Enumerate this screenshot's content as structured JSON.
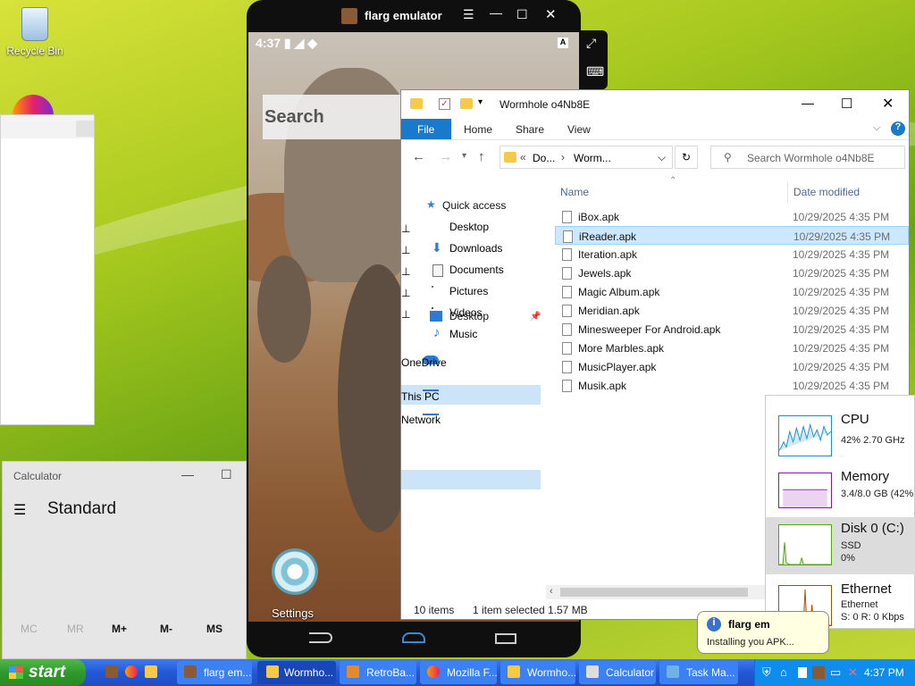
{
  "desktop": {
    "recycle_bin_label": "Recycle Bin"
  },
  "calculator": {
    "title": "Calculator",
    "mode": "Standard",
    "memory_buttons": [
      "MC",
      "MR",
      "M+",
      "M-",
      "MS"
    ]
  },
  "emulator": {
    "title": "flarg emulator",
    "time": "4:37",
    "search_text": "Search",
    "settings_label": "Settings"
  },
  "explorer": {
    "title": "Wormhole o4Nb8E",
    "ribbon": {
      "file": "File",
      "home": "Home",
      "share": "Share",
      "view": "View"
    },
    "address": {
      "part1": "Do...",
      "part2": "Worm..."
    },
    "search_placeholder": "Search Wormhole o4Nb8E",
    "nav": {
      "quick_access": "Quick access",
      "desktop": "Desktop",
      "downloads": "Downloads",
      "documents": "Documents",
      "pictures": "Pictures",
      "videos": "Videos",
      "music": "Music",
      "onedrive": "OneDrive",
      "this_pc": "This PC",
      "network": "Network"
    },
    "columns": {
      "name": "Name",
      "date": "Date modified"
    },
    "files": [
      {
        "name": "iBox.apk",
        "date": "10/29/2025 4:35 PM"
      },
      {
        "name": "iReader.apk",
        "date": "10/29/2025 4:35 PM"
      },
      {
        "name": "Iteration.apk",
        "date": "10/29/2025 4:35 PM"
      },
      {
        "name": "Jewels.apk",
        "date": "10/29/2025 4:35 PM"
      },
      {
        "name": "Magic Album.apk",
        "date": "10/29/2025 4:35 PM"
      },
      {
        "name": "Meridian.apk",
        "date": "10/29/2025 4:35 PM"
      },
      {
        "name": "Minesweeper For Android.apk",
        "date": "10/29/2025 4:35 PM"
      },
      {
        "name": "More Marbles.apk",
        "date": "10/29/2025 4:35 PM"
      },
      {
        "name": "MusicPlayer.apk",
        "date": "10/29/2025 4:35 PM"
      },
      {
        "name": "Musik.apk",
        "date": "10/29/2025 4:35 PM"
      }
    ],
    "status": {
      "items": "10 items",
      "selected": "1 item selected",
      "size": "1.57 MB"
    }
  },
  "task_manager": {
    "cpu": {
      "name": "CPU",
      "detail": "42%  2.70 GHz"
    },
    "memory": {
      "name": "Memory",
      "detail": "3.4/8.0 GB (42%"
    },
    "disk": {
      "name": "Disk 0 (C:)",
      "type": "SSD",
      "usage": "0%"
    },
    "ethernet": {
      "name": "Ethernet",
      "adapter": "Ethernet",
      "rate": "S: 0  R: 0 Kbps"
    }
  },
  "balloon": {
    "title": "flarg em",
    "message": "Installing you APK..."
  },
  "taskbar": {
    "start": "start",
    "buttons": [
      "flarg em...",
      "Wormho...",
      "RetroBa...",
      "Mozilla F...",
      "Wormho...",
      "Calculator",
      "Task Ma..."
    ],
    "clock": "4:37 PM"
  },
  "colors": {
    "accent": "#1979ca",
    "taskbar": "#245edb",
    "start_green": "#2f9a2a"
  }
}
